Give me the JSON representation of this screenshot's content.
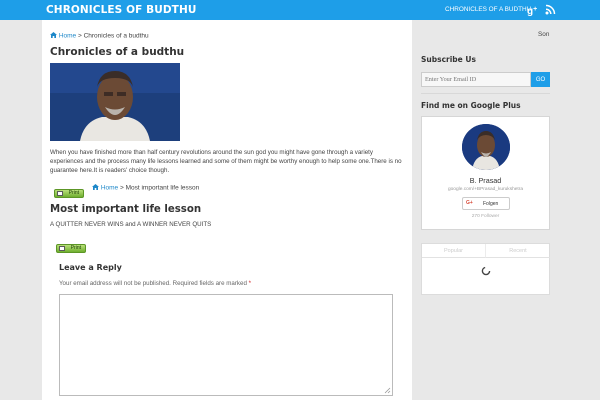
{
  "header": {
    "site_title": "CHRONICLES OF BUDTHU",
    "nav_link": "CHRONICLES OF A BUDTHU",
    "accent_color": "#1e9ee8",
    "icons": [
      "google-plus-icon",
      "rss-icon"
    ]
  },
  "main": {
    "breadcrumb": {
      "home": "Home",
      "separator": " > ",
      "current": "Chronicles of a budthu"
    },
    "page_title": "Chronicles of a budthu",
    "intro": "When you have finished more than half century revolutions around the sun god you might have gone through a variety experiences and the process many life lessons learned and some of them might be worthy enough to help some one.There is no guarantee here.It is readers' choice though.",
    "print_label": "Print",
    "breadcrumb2": {
      "home": "Home",
      "separator": " > ",
      "current": "Most important life lesson"
    },
    "post_title": "Most important life lesson",
    "post_body": "A QUITTER NEVER WINS and A WINNER NEVER QUITS",
    "reply": {
      "title": "Leave a Reply",
      "note": "Your email address will not be published. Required fields are marked ",
      "required_mark": "*"
    }
  },
  "sidebar": {
    "clipped_text": "Son",
    "subscribe": {
      "title": "Subscribe Us",
      "placeholder": "Enter Your Email ID",
      "go_label": "GO"
    },
    "gplus": {
      "title": "Find me on Google Plus",
      "name": "B. Prasad",
      "url": "google.com/+BPrasad_kurukshetra",
      "follow_mark": "G+",
      "follow_label": "Folgen",
      "followers": "270 Follower"
    },
    "tabs": [
      "Popular",
      "Recent"
    ]
  }
}
